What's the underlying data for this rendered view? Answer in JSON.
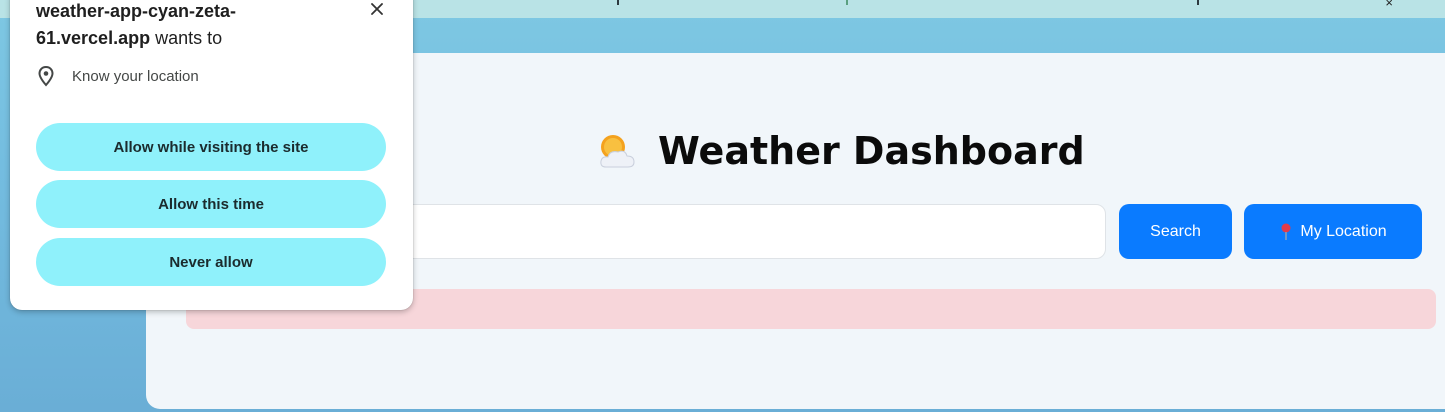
{
  "popup": {
    "domain": "weather-app-cyan-zeta-61.vercel.app",
    "wants_to": "wants to",
    "permission": "Know your location",
    "allow_visiting": "Allow while visiting the site",
    "allow_once": "Allow this time",
    "never_allow": "Never allow",
    "close_icon": "×"
  },
  "page": {
    "title": "Weather Dashboard",
    "title_icon": "sun-behind-cloud-icon",
    "search_input_value": "",
    "search_button": "Search",
    "location_button": "My Location",
    "location_button_icon": "round-pushpin-icon"
  },
  "colors": {
    "accent_button": "#0a7bff",
    "popup_button": "#8ff1fb",
    "error_bar": "#f7d6da",
    "background": "#74bde0"
  }
}
